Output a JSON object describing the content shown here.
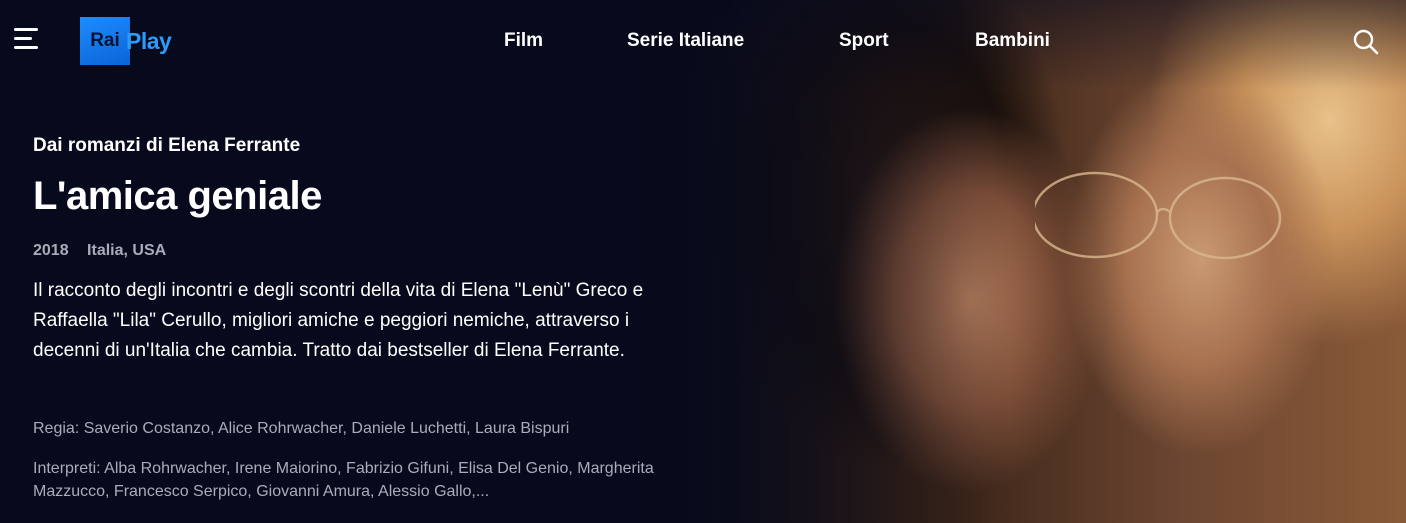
{
  "header": {
    "logo_rai": "Rai",
    "logo_play": "Play",
    "nav": [
      "Film",
      "Serie Italiane",
      "Sport",
      "Bambini"
    ],
    "menu_icon": "hamburger-menu-icon",
    "search_icon": "search-icon"
  },
  "hero": {
    "kicker": "Dai romanzi di Elena Ferrante",
    "title": "L'amica geniale",
    "year": "2018",
    "country": "Italia, USA",
    "description": "Il racconto degli incontri e degli scontri della vita di Elena \"Lenù\" Greco e Raffaella \"Lila\" Cerullo, migliori amiche e peggiori nemiche, attraverso i decenni di un'Italia che cambia. Tratto dai bestseller di Elena Ferrante.",
    "regia": "Regia: Saverio Costanzo, Alice Rohrwacher, Daniele Luchetti, Laura Bispuri",
    "interpreti": "Interpreti: Alba Rohrwacher, Irene Maiorino, Fabrizio Gifuni, Elisa Del Genio, Margherita Mazzucco, Francesco Serpico, Giovanni Amura, Alessio Gallo,..."
  },
  "colors": {
    "background": "#070a1c",
    "accent": "#1e8cff",
    "muted_text": "#a9acb9"
  }
}
